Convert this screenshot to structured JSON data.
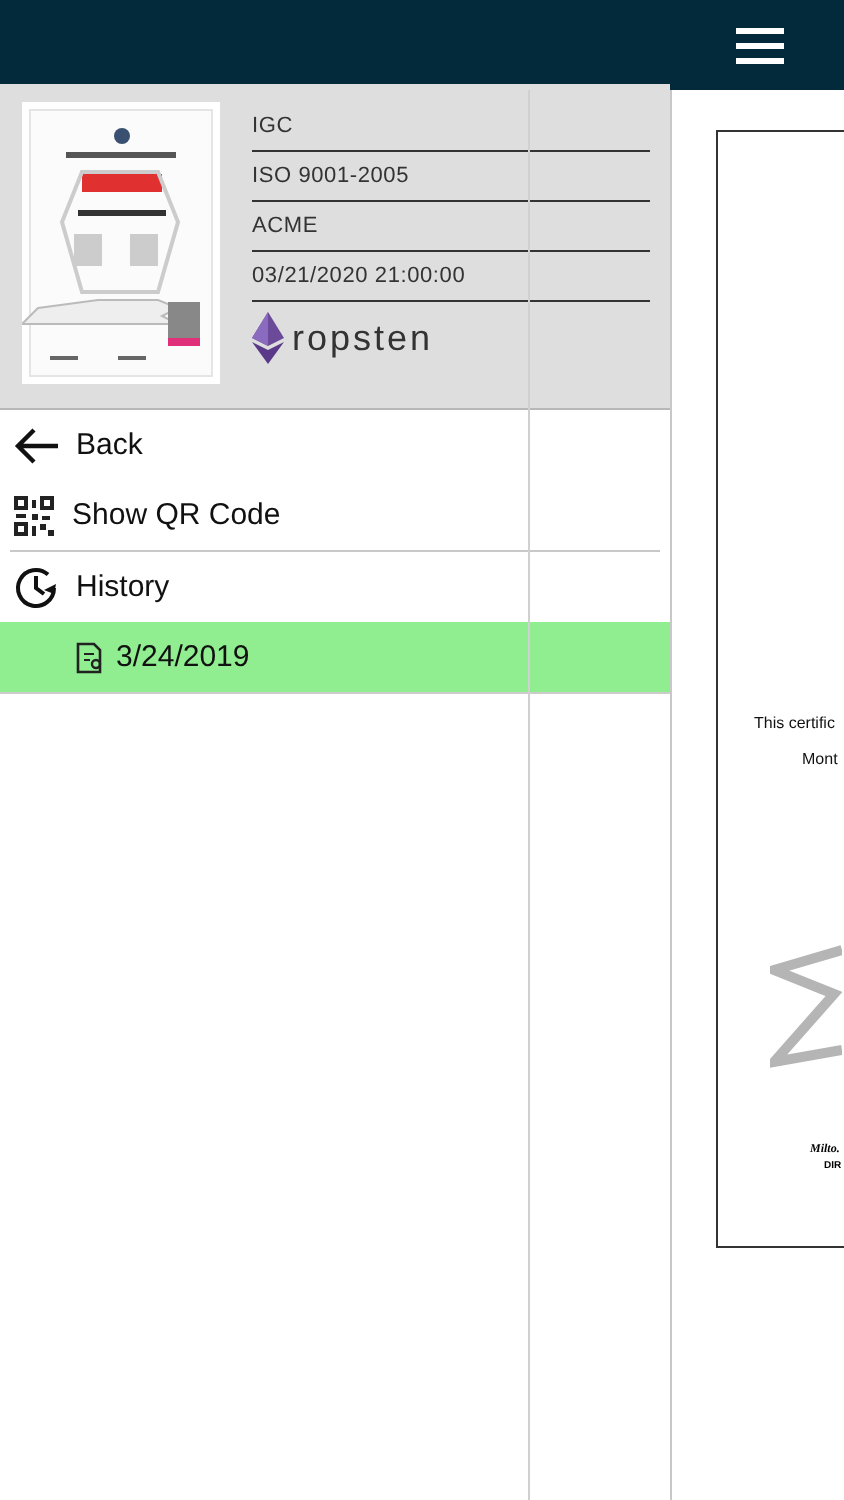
{
  "certificate": {
    "fields": [
      "IGC",
      "ISO 9001-2005",
      "ACME",
      "03/21/2020 21:00:00"
    ],
    "network": "ropsten"
  },
  "menu": [
    {
      "kind": "back",
      "label": "Back"
    },
    {
      "kind": "qr",
      "label": "Show QR Code"
    },
    {
      "kind": "history",
      "label": "History"
    }
  ],
  "history": [
    {
      "date": "3/24/2019",
      "selected": true
    }
  ],
  "preview": {
    "lines": [
      "This certific",
      "Mont"
    ],
    "signature": "Milto.",
    "role": "DIR"
  }
}
